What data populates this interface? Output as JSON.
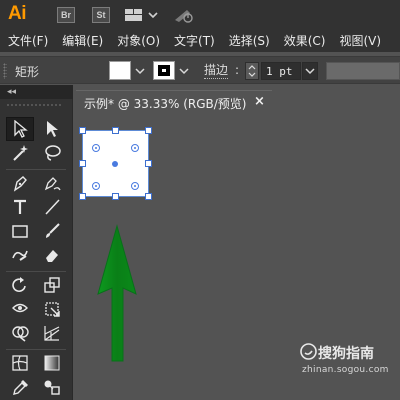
{
  "app": {
    "logo": "Ai",
    "bridge_label": "Br",
    "stock_label": "St",
    "layout_icon": "workspace-grid-icon",
    "sync_icon": "sync-rocket-icon"
  },
  "menu": {
    "items": [
      "文件(F)",
      "编辑(E)",
      "对象(O)",
      "文字(T)",
      "选择(S)",
      "效果(C)",
      "视图(V)"
    ]
  },
  "control_bar": {
    "selection_label": "矩形",
    "fill_color": "#ffffff",
    "stroke_color": "#000000",
    "stroke_label": "描边",
    "stroke_colon": ":",
    "stroke_weight": "1 pt"
  },
  "toolbar": {
    "collapse_label": "◂◂",
    "tools": [
      "selection-tool-icon",
      "direct-selection-tool-icon",
      "magic-wand-tool-icon",
      "lasso-tool-icon",
      "pen-tool-icon",
      "curvature-tool-icon",
      "type-tool-icon",
      "line-tool-icon",
      "rectangle-tool-icon",
      "paintbrush-tool-icon",
      "shaper-tool-icon",
      "eraser-tool-icon",
      "rotate-tool-icon",
      "scale-tool-icon",
      "width-tool-icon",
      "free-transform-tool-icon",
      "shape-builder-tool-icon",
      "perspective-grid-tool-icon",
      "mesh-tool-icon",
      "gradient-tool-icon",
      "eyedropper-tool-icon",
      "blend-tool-icon"
    ]
  },
  "document": {
    "tab_title": "示例* @ 33.33% (RGB/预览)",
    "close_symbol": "×"
  },
  "canvas": {
    "selection_color": "#3d6fcf",
    "arrow_color": "#0b8a1a"
  },
  "watermark": {
    "brand": "搜狗指南",
    "url": "zhinan.sogou.com"
  }
}
